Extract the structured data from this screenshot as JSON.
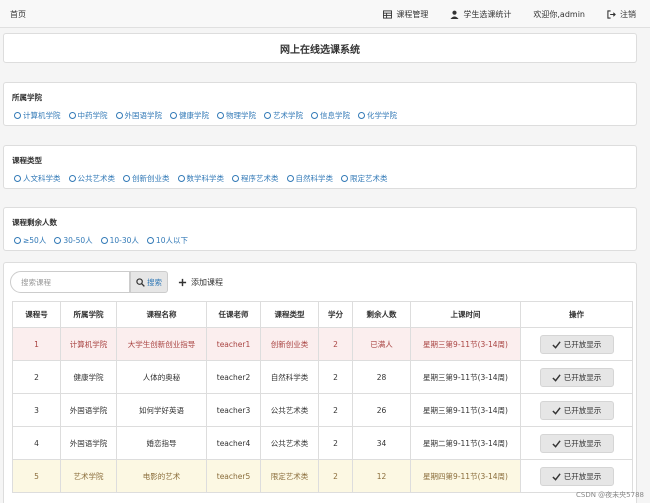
{
  "nav": {
    "home": "首页",
    "course_manage": "课程管理",
    "student_stats": "学生选课统计",
    "welcome": "欢迎你,admin",
    "logout": "注销"
  },
  "title": "网上在线选课系统",
  "filters": [
    {
      "label": "所属学院",
      "options": [
        "计算机学院",
        "中药学院",
        "外国语学院",
        "健康学院",
        "物理学院",
        "艺术学院",
        "信息学院",
        "化学学院"
      ]
    },
    {
      "label": "课程类型",
      "options": [
        "人文科学类",
        "公共艺术类",
        "创新创业类",
        "数学科学类",
        "程序艺术类",
        "自然科学类",
        "限定艺术类"
      ]
    },
    {
      "label": "课程剩余人数",
      "options": [
        "≥50人",
        "30-50人",
        "10-30人",
        "10人以下"
      ]
    }
  ],
  "search": {
    "placeholder": "搜索课程",
    "button": "搜索",
    "add": "添加课程"
  },
  "table": {
    "headers": [
      "课程号",
      "所属学院",
      "课程名称",
      "任课老师",
      "课程类型",
      "学分",
      "剩余人数",
      "上课时间",
      "操作"
    ],
    "rows": [
      {
        "state": "full",
        "cells": [
          "1",
          "计算机学院",
          "大学生创新创业指导",
          "teacher1",
          "创新创业类",
          "2",
          "已满人",
          "星期三第9-11节(3-14周)"
        ],
        "op": "已开放显示"
      },
      {
        "state": "normal",
        "cells": [
          "2",
          "健康学院",
          "人体的奥秘",
          "teacher2",
          "自然科学类",
          "2",
          "28",
          "星期三第9-11节(3-14周)"
        ],
        "op": "已开放显示"
      },
      {
        "state": "normal",
        "cells": [
          "3",
          "外国语学院",
          "如何学好英语",
          "teacher3",
          "公共艺术类",
          "2",
          "26",
          "星期三第9-11节(3-14周)"
        ],
        "op": "已开放显示"
      },
      {
        "state": "normal",
        "cells": [
          "4",
          "外国语学院",
          "婚恋指导",
          "teacher4",
          "公共艺术类",
          "2",
          "34",
          "星期二第9-11节(3-14周)"
        ],
        "op": "已开放显示"
      },
      {
        "state": "warn",
        "cells": [
          "5",
          "艺术学院",
          "电影的艺术",
          "teacher5",
          "限定艺术类",
          "2",
          "12",
          "星期四第9-11节(3-14周)"
        ],
        "op": "已开放显示"
      }
    ]
  },
  "watermark": "CSDN @夜未央5788"
}
